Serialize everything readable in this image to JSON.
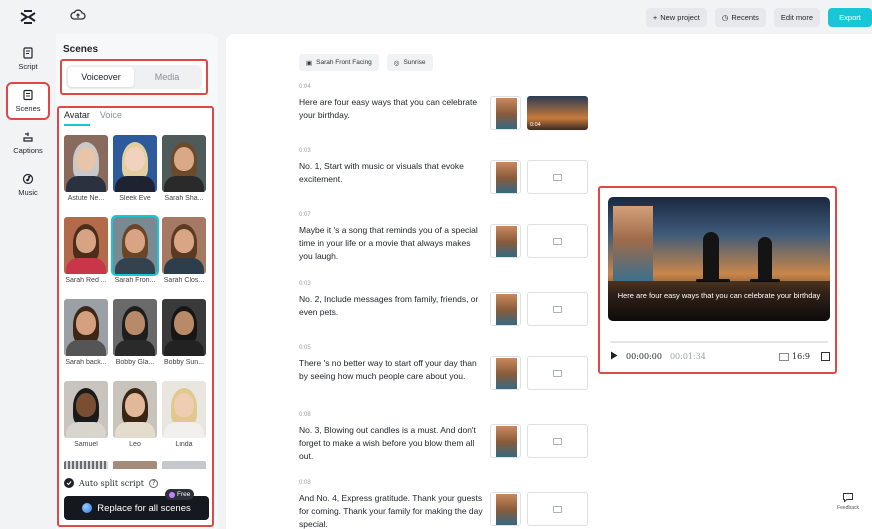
{
  "topbar": {
    "logo_icon": "capcut-logo-icon",
    "cloud_icon": "cloud-upload-icon",
    "new_project": "New project",
    "recents": "Recents",
    "edit_more": "Edit more",
    "export": "Export"
  },
  "rail": [
    {
      "label": "Script",
      "icon": "script-icon",
      "active": false
    },
    {
      "label": "Scenes",
      "icon": "scenes-icon",
      "active": true
    },
    {
      "label": "Captions",
      "icon": "captions-icon",
      "active": false
    },
    {
      "label": "Music",
      "icon": "music-icon",
      "active": false
    }
  ],
  "panel": {
    "title": "Scenes",
    "segments": [
      "Voiceover",
      "Media"
    ],
    "subtabs": [
      "Avatar",
      "Voice"
    ],
    "avatars": [
      {
        "name": "Astute Ne...",
        "skin": "#e8c4a8",
        "hair": "#c9c9c9",
        "bg": "#8a6a5c",
        "cloth": "#2a3240"
      },
      {
        "name": "Sleek Eve",
        "skin": "#f1d2bf",
        "hair": "#e3cf9c",
        "bg": "#2d5a9a",
        "cloth": "#1d2330"
      },
      {
        "name": "Sarah Sha...",
        "skin": "#d9a886",
        "hair": "#6a4a2a",
        "bg": "#4f5a5a",
        "cloth": "#2a2a2a"
      },
      {
        "name": "Sarah Red ...",
        "skin": "#d7a384",
        "hair": "#4a2e1a",
        "bg": "#b26a4a",
        "cloth": "#c8364a"
      },
      {
        "name": "Sarah Fron...",
        "skin": "#d8a483",
        "hair": "#6a4528",
        "bg": "#7a8a92",
        "cloth": "#33424e",
        "selected": true
      },
      {
        "name": "Sarah Clos...",
        "skin": "#d9a585",
        "hair": "#5a3a22",
        "bg": "#a67a62",
        "cloth": "#2c3d4c"
      },
      {
        "name": "Sarah back...",
        "skin": "#d5a080",
        "hair": "#3e2616",
        "bg": "#9aa0a6",
        "cloth": "#555"
      },
      {
        "name": "Bobby Gla...",
        "skin": "#b98a6a",
        "hair": "#1e1e1e",
        "bg": "#6a6a6a",
        "cloth": "#2a2a2a"
      },
      {
        "name": "Bobby Sun...",
        "skin": "#b98a6a",
        "hair": "#161616",
        "bg": "#3a3a3a",
        "cloth": "#222"
      },
      {
        "name": "Samuel",
        "skin": "#7a4e32",
        "hair": "#1a1a1a",
        "bg": "#c9c4bd",
        "cloth": "#d9d4cc"
      },
      {
        "name": "Leo",
        "skin": "#e1b99a",
        "hair": "#3a2416",
        "bg": "#c8c3bb",
        "cloth": "#e6dccd"
      },
      {
        "name": "Linda",
        "skin": "#efcdb2",
        "hair": "#e1c88c",
        "bg": "#e9e6e2",
        "cloth": "#f2f0ec"
      }
    ],
    "auto_split": "Auto split script",
    "free_badge": "Free",
    "replace_button": "Replace for all scenes"
  },
  "main": {
    "chips": [
      {
        "label": "Sarah Front Facing",
        "icon": "avatar-icon"
      },
      {
        "label": "Sunrise",
        "icon": "music-note-icon"
      }
    ],
    "scenes": [
      {
        "time": "0:04",
        "text": "Here are four easy ways that you can celebrate your birthday.",
        "media": "image",
        "duration": "0:04"
      },
      {
        "time": "0:03",
        "text": "No. 1, Start with music or visuals that evoke excitement.",
        "media": "empty"
      },
      {
        "time": "0:07",
        "text": "Maybe it 's a song that reminds you of a special time in your life or a movie that always makes you laugh.",
        "media": "empty"
      },
      {
        "time": "0:03",
        "text": "No. 2, Include messages from family, friends, or even pets.",
        "media": "empty"
      },
      {
        "time": "0:05",
        "text": "There 's no better way to start off your day than by seeing how much people care about you.",
        "media": "empty"
      },
      {
        "time": "0:08",
        "text": "No. 3, Blowing out candles is a must. And don't forget to make a wish before you blow them all out.",
        "media": "empty"
      },
      {
        "time": "0:08",
        "text": "And No. 4, Express gratitude. Thank your guests for coming. Thank your family for making the day special.",
        "media": "empty"
      }
    ]
  },
  "preview": {
    "caption": "Here are four easy ways that you can celebrate your birthday",
    "current_time": "00:00:00",
    "total_time": "00:01:34",
    "ratio": "16:9"
  },
  "feedback": "Feedback"
}
